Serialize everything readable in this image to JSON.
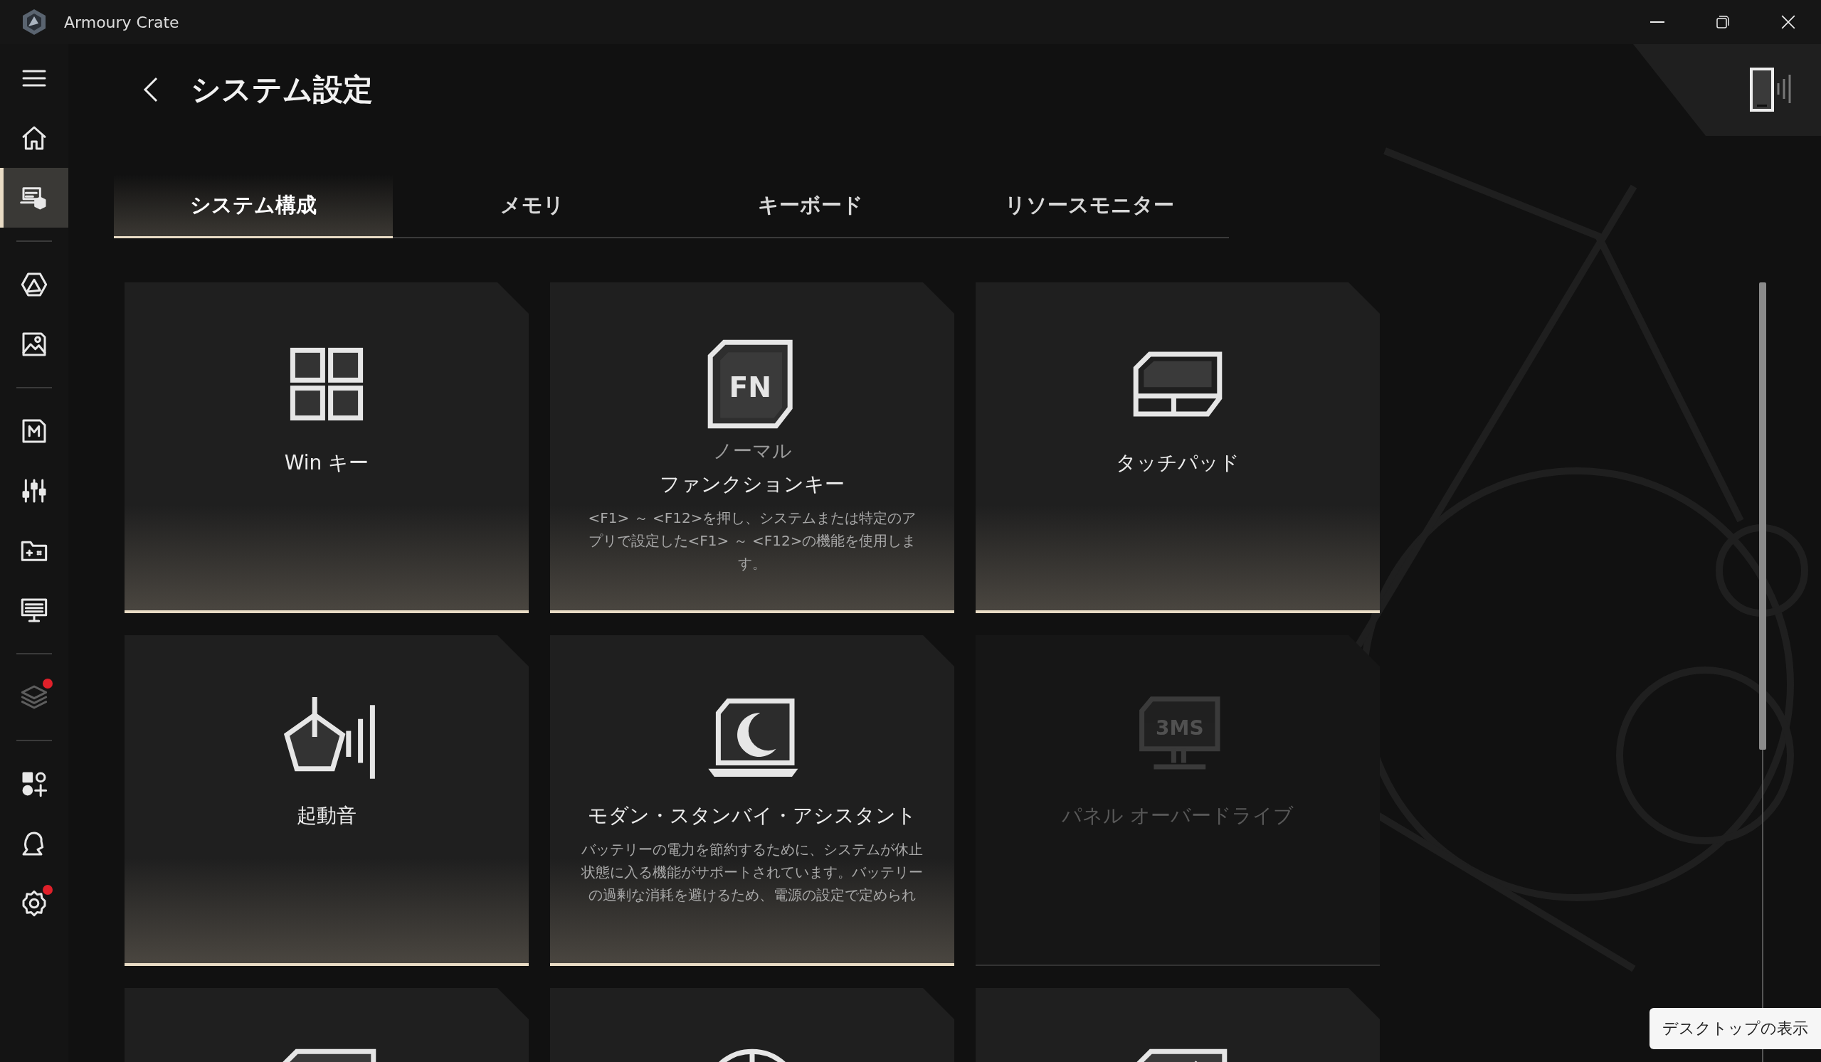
{
  "window": {
    "title": "Armoury Crate"
  },
  "sidebar": {
    "groups": [
      {
        "items": [
          {
            "kind": "menu",
            "selected": false,
            "disabled": false,
            "badge": false
          },
          {
            "kind": "home",
            "selected": false,
            "disabled": false,
            "badge": false
          },
          {
            "kind": "device",
            "selected": true,
            "disabled": false,
            "badge": false
          }
        ]
      },
      {
        "items": [
          {
            "kind": "hexagon",
            "selected": false,
            "disabled": false,
            "badge": false
          },
          {
            "kind": "image",
            "selected": false,
            "disabled": false,
            "badge": false
          }
        ]
      },
      {
        "items": [
          {
            "kind": "mkey",
            "selected": false,
            "disabled": false,
            "badge": false
          },
          {
            "kind": "sliders",
            "selected": false,
            "disabled": false,
            "badge": false
          },
          {
            "kind": "folder",
            "selected": false,
            "disabled": false,
            "badge": false
          },
          {
            "kind": "display",
            "selected": false,
            "disabled": false,
            "badge": false
          }
        ]
      },
      {
        "items": [
          {
            "kind": "layers",
            "selected": false,
            "disabled": true,
            "badge": true
          }
        ]
      },
      {
        "items": [
          {
            "kind": "apps",
            "selected": false,
            "disabled": false,
            "badge": false
          },
          {
            "kind": "user",
            "selected": false,
            "disabled": false,
            "badge": false
          },
          {
            "kind": "settings",
            "selected": false,
            "disabled": false,
            "badge": true
          }
        ]
      }
    ]
  },
  "page": {
    "title": "システム設定"
  },
  "tabs": [
    {
      "label": "システム構成",
      "selected": true
    },
    {
      "label": "メモリ",
      "selected": false
    },
    {
      "label": "キーボード",
      "selected": false
    },
    {
      "label": "リソースモニター",
      "selected": false
    }
  ],
  "cards": [
    {
      "kind": "windows",
      "label": "Win キー",
      "disabled": false
    },
    {
      "kind": "fn",
      "icon_text": "FN",
      "status": "ノーマル",
      "label": "ファンクションキー",
      "description": "<F1> ～ <F12>を押し、システムまたは特定のアプリで設定した<F1> ～ <F12>の機能を使用します。",
      "disabled": false
    },
    {
      "kind": "touchpad",
      "label": "タッチパッド",
      "disabled": false
    },
    {
      "kind": "sound",
      "label": "起動音",
      "disabled": false
    },
    {
      "kind": "standby",
      "label": "モダン・スタンバイ・アシスタント",
      "description": "バッテリーの電力を節約するために、システムが休止状態に入る機能がサポートされています。バッテリーの過剰な消耗を避けるため、電源の設定で定められ",
      "disabled": false
    },
    {
      "kind": "monitor",
      "icon_text": "3MS",
      "label": "パネル オーバードライブ",
      "disabled": true
    },
    {
      "kind": "keyboard"
    },
    {
      "kind": "dial"
    },
    {
      "kind": "chamfer"
    }
  ],
  "tooltip": {
    "text": "デスクトップの表示"
  }
}
